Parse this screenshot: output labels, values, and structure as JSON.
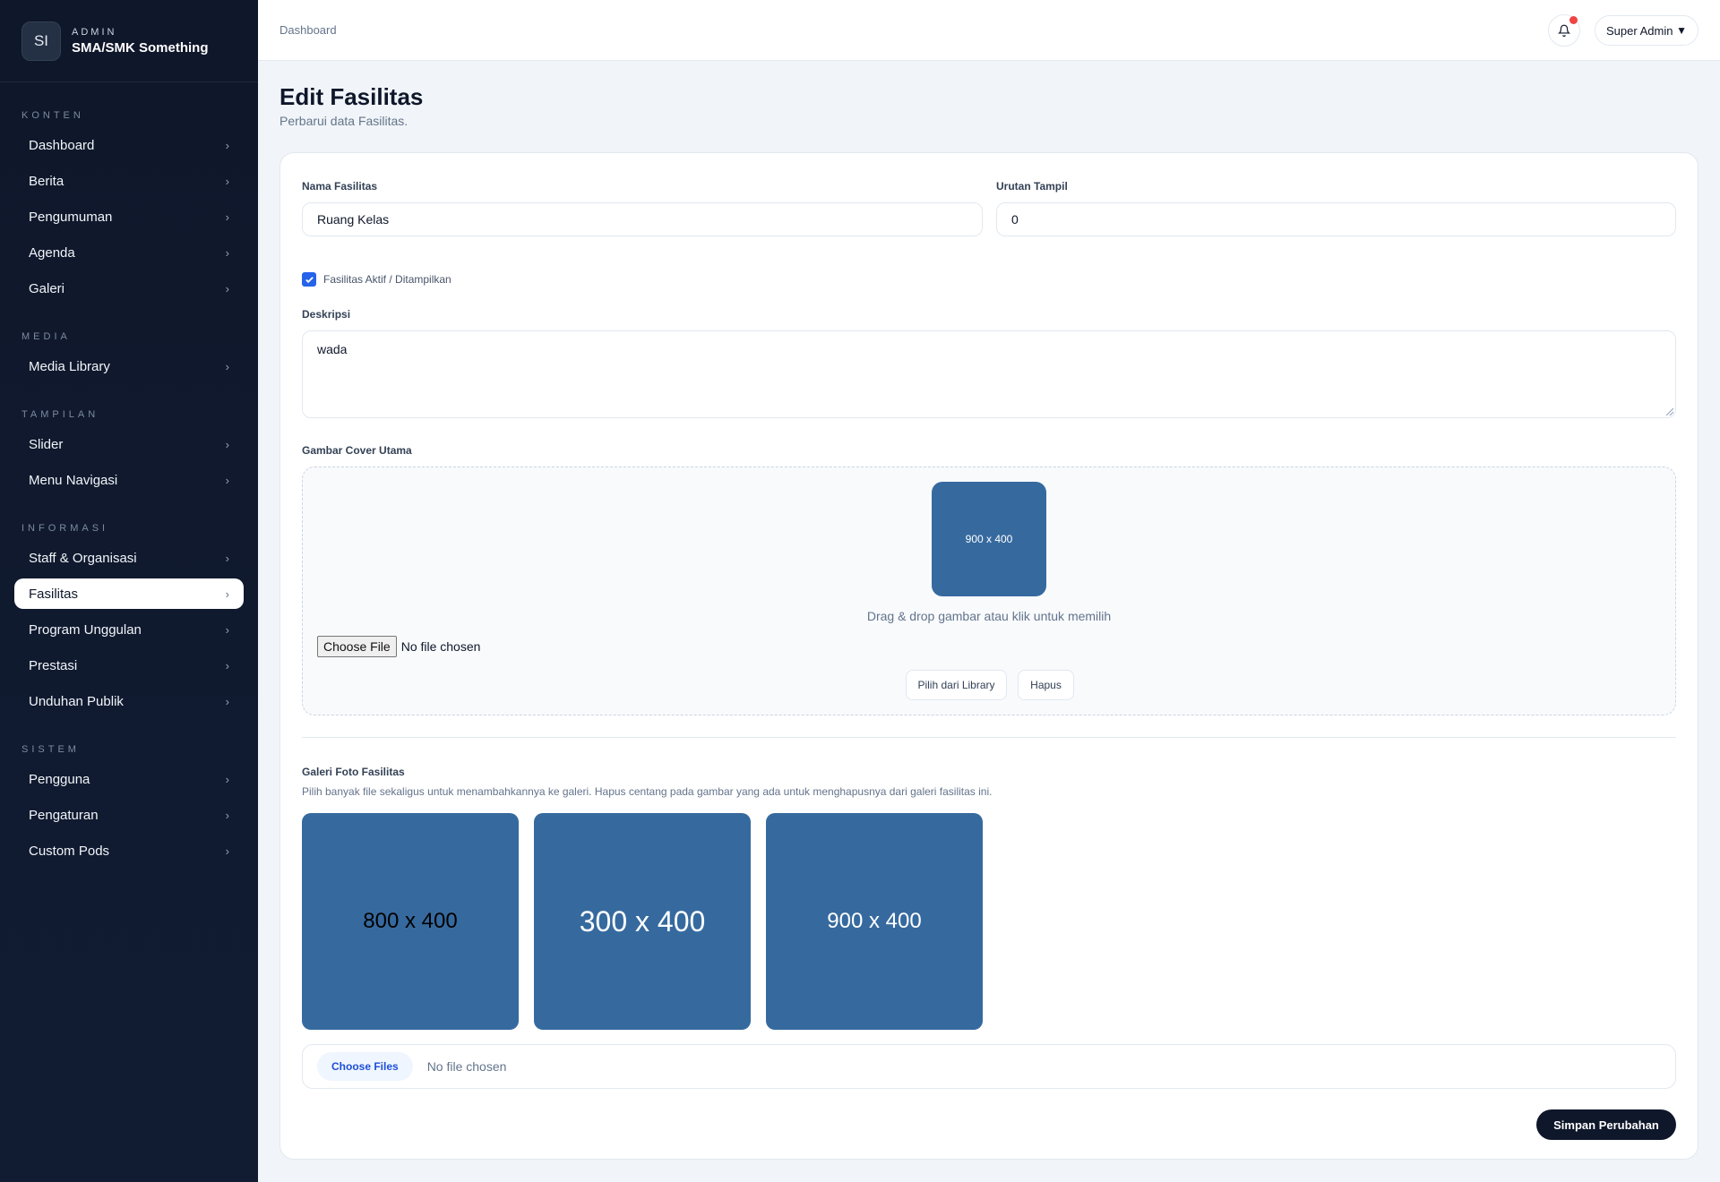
{
  "brand": {
    "logo": "SI",
    "sub": "ADMIN",
    "name": "SMA/SMK Something"
  },
  "sidebar": {
    "sections": [
      {
        "title": "KONTEN",
        "items": [
          {
            "label": "Dashboard",
            "name": "dashboard"
          },
          {
            "label": "Berita",
            "name": "berita"
          },
          {
            "label": "Pengumuman",
            "name": "pengumuman"
          },
          {
            "label": "Agenda",
            "name": "agenda"
          },
          {
            "label": "Galeri",
            "name": "galeri"
          }
        ]
      },
      {
        "title": "MEDIA",
        "items": [
          {
            "label": "Media Library",
            "name": "media-library"
          }
        ]
      },
      {
        "title": "TAMPILAN",
        "items": [
          {
            "label": "Slider",
            "name": "slider"
          },
          {
            "label": "Menu Navigasi",
            "name": "menu-navigasi"
          }
        ]
      },
      {
        "title": "INFORMASI",
        "items": [
          {
            "label": "Staff & Organisasi",
            "name": "staff-organisasi"
          },
          {
            "label": "Fasilitas",
            "name": "fasilitas",
            "active": true
          },
          {
            "label": "Program Unggulan",
            "name": "program-unggulan"
          },
          {
            "label": "Prestasi",
            "name": "prestasi"
          },
          {
            "label": "Unduhan Publik",
            "name": "unduhan-publik"
          }
        ]
      },
      {
        "title": "SISTEM",
        "items": [
          {
            "label": "Pengguna",
            "name": "pengguna"
          },
          {
            "label": "Pengaturan",
            "name": "pengaturan"
          },
          {
            "label": "Custom Pods",
            "name": "custom-pods"
          }
        ]
      }
    ]
  },
  "topbar": {
    "breadcrumb": "Dashboard",
    "user": "Super Admin",
    "notification_icon": "bell-icon"
  },
  "page": {
    "title": "Edit Fasilitas",
    "subtitle": "Perbarui data Fasilitas."
  },
  "form": {
    "nama_label": "Nama Fasilitas",
    "nama_value": "Ruang Kelas",
    "urutan_label": "Urutan Tampil",
    "urutan_value": "0",
    "aktif_label": "Fasilitas Aktif / Ditampilkan",
    "aktif_checked": true,
    "deskripsi_label": "Deskripsi",
    "deskripsi_value": "wada",
    "cover_label": "Gambar Cover Utama",
    "cover_preview": "900 x 400",
    "drop_text": "Drag & drop gambar atau klik untuk memilih",
    "cover_file_button": "Choose File",
    "cover_file_status": "No file chosen",
    "library_button": "Pilih dari Library",
    "hapus_button": "Hapus",
    "galeri_label": "Galeri Foto Fasilitas",
    "galeri_hint": "Pilih banyak file sekaligus untuk menambahkannya ke galeri. Hapus centang pada gambar yang ada untuk menghapusnya dari galeri fasilitas ini.",
    "gallery": [
      {
        "text": "800 x 400",
        "text_color": "#000000"
      },
      {
        "text": "300 x 400",
        "text_color": "#ffffff"
      },
      {
        "text": "900 x 400",
        "text_color": "#ffffff"
      }
    ],
    "galeri_file_button": "Choose Files",
    "galeri_file_status": "No file chosen",
    "save_button": "Simpan Perubahan"
  },
  "colors": {
    "sidebar_bg": "#0f172a",
    "accent": "#2563eb",
    "placeholder_image": "#366a9f",
    "notification_dot": "#ef4444"
  }
}
